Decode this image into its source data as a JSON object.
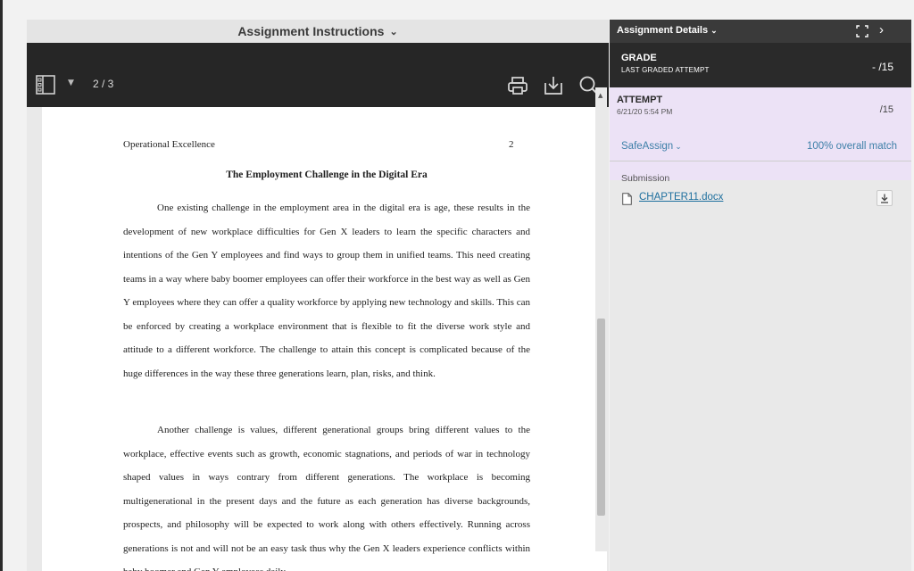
{
  "viewer": {
    "title": "Assignment Instructions",
    "page_indicator": "2 / 3"
  },
  "document": {
    "running_head": "Operational Excellence",
    "page_number": "2",
    "title": "The Employment Challenge in the Digital Era",
    "paragraph1": "One existing challenge in the employment area in the digital era is age, these results in the development of new workplace difficulties for Gen X leaders to learn the specific characters and intentions of the Gen Y employees and find ways to group them in unified teams. This need creating teams in a way where baby boomer employees can offer their workforce in the best way as well as Gen Y employees where they can offer a quality workforce by applying new technology and skills. This can be enforced by creating a workplace environment that is flexible to fit the diverse work style and attitude to a different workforce. The challenge to attain this concept is complicated because of the huge differences in the way these three generations learn, plan, risks, and think.",
    "paragraph2": "Another challenge is values, different generational groups bring different values to the workplace, effective events such as growth, economic stagnations, and periods of war in technology shaped values in ways contrary from different generations.  The workplace is becoming multigenerational in the present days and the future as each generation has diverse backgrounds, prospects, and philosophy will be expected to work along with others effectively. Running across generations is not and will not be an easy task thus why the Gen X leaders experience conflicts within baby boomer and Gen Y employees daily."
  },
  "details": {
    "title": "Assignment Details",
    "grade_label": "GRADE",
    "grade_sublabel": "LAST GRADED ATTEMPT",
    "grade_score": "- /15",
    "attempt_label": "ATTEMPT",
    "attempt_date": "6/21/20 5:54 PM",
    "attempt_score": "/15",
    "safeassign_label": "SafeAssign",
    "match_text": "100% overall match",
    "submission_label": "Submission",
    "file_name": "CHAPTER11.docx"
  },
  "icons": {
    "sidebar_toggle": "sidebar-toggle-icon",
    "print": "print-icon",
    "download": "download-icon",
    "search": "search-icon",
    "expand": "expand-icon",
    "next": "chevron-right-icon",
    "file": "document-icon"
  },
  "colors": {
    "toolbar_bg": "#262626",
    "attempt_bg": "#ece2f6",
    "link": "#1e6f9e",
    "accent_link": "#3d7fa8"
  }
}
